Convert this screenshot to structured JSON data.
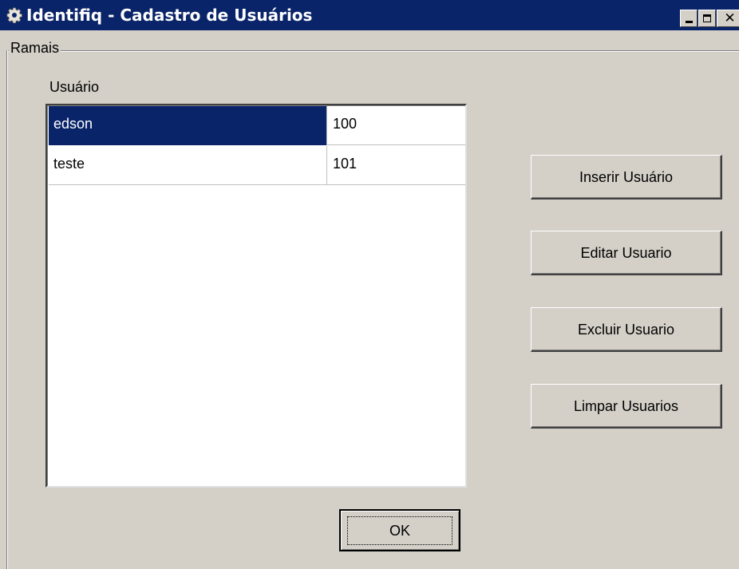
{
  "window": {
    "title": "Identifiq - Cadastro de Usuários",
    "icon": "gear-icon",
    "controls": {
      "minimize": "minimize-icon",
      "maximize": "maximize-icon",
      "close": "close-icon"
    }
  },
  "group": {
    "legend": "Ramais"
  },
  "users": {
    "label": "Usuário",
    "rows": [
      {
        "name": "edson",
        "extension": "100",
        "selected": true
      },
      {
        "name": "teste",
        "extension": "101",
        "selected": false
      }
    ]
  },
  "buttons": {
    "insert": "Inserir Usuário",
    "edit": "Editar Usuario",
    "delete": "Excluir Usuario",
    "clear": "Limpar Usuarios",
    "ok": "OK"
  },
  "colors": {
    "titlebar": "#0a246a",
    "face": "#d4d0c8",
    "selection": "#0a246a"
  }
}
